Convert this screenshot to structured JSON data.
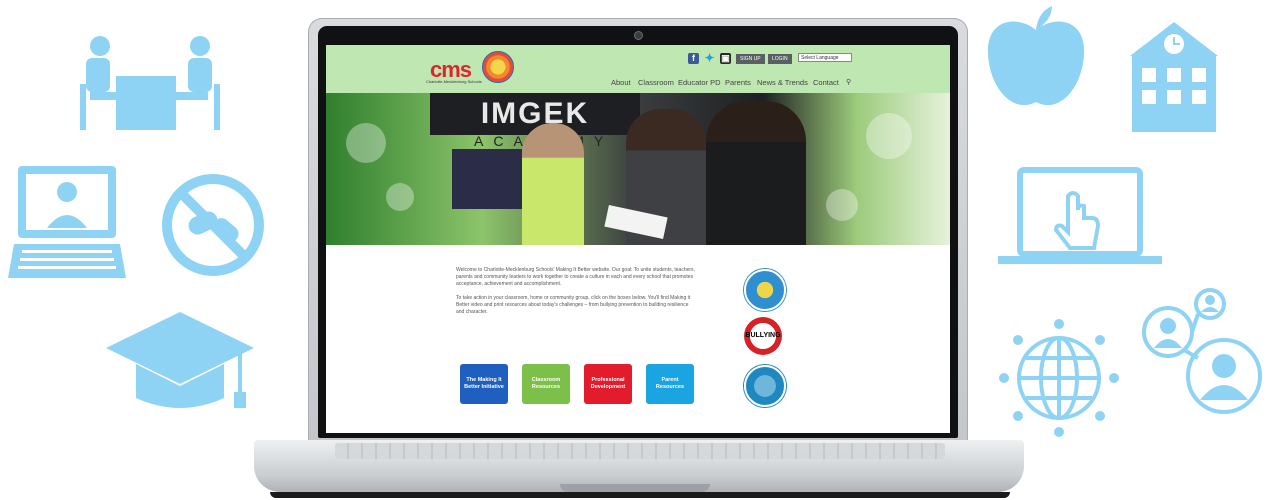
{
  "site": {
    "logo_text": "cms",
    "logo_subtitle": "Charlotte-Mecklenburg Schools",
    "seal_label": "Making It Better",
    "social": [
      "f",
      "t",
      "ig"
    ],
    "signup_label": "SIGN UP",
    "login_label": "LOGIN",
    "language_select": "Select Language",
    "nav": [
      "About",
      "Classroom",
      "Educator PD",
      "Parents",
      "News & Trends",
      "Contact"
    ],
    "search_icon": "search-icon",
    "hero_sign": "IMGEK",
    "hero_sub": "ACADEMY",
    "intro_p1": "Welcome to Charlotte-Mecklenburg Schools' Making It Better website. Our goal: To unite students, teachers, parents and community leaders to work together to create a culture in each and every school that promotes acceptance, achievement and accomplishment.",
    "intro_p2": "To take action in your classroom, home or community group, click on the boxes below. You'll find Making it Better video and print resources about today's challenges – from bullying prevention to building resilience and character.",
    "badge_bullying": "BULLYING",
    "tiles": [
      "The Making It Better Initiative",
      "Classroom Resources",
      "Professional Development",
      "Parent Resources"
    ],
    "colors": {
      "header_bg": "#bfe7b2",
      "accent_red": "#e21b2d",
      "tile_blue": "#1f5fbf",
      "tile_green": "#7cc04a",
      "tile_cyan": "#1aa4e2",
      "icon_blue": "#8fd3f4"
    }
  },
  "decorations": [
    "meeting-icon",
    "laptop-user-icon",
    "no-pills-icon",
    "graduation-cap-icon",
    "apple-icon",
    "school-building-icon",
    "laptop-click-icon",
    "globe-network-icon",
    "user-network-icon"
  ]
}
